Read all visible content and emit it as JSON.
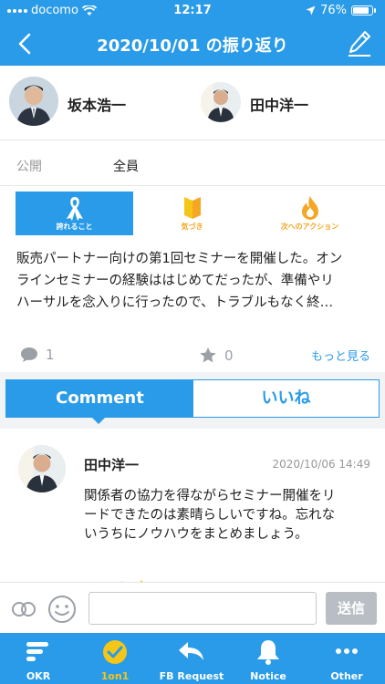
{
  "status_bar": {
    "carrier": "docomo",
    "time": "12:17",
    "battery": "76%"
  },
  "nav": {
    "title": "2020/10/01 の振り返り"
  },
  "people": {
    "left_name": "坂本浩一",
    "right_name": "田中洋一"
  },
  "visibility": {
    "label": "公開",
    "value": "全員"
  },
  "reflection_tabs": [
    {
      "label": "誇れること",
      "active": true,
      "icon": "ribbon-icon"
    },
    {
      "label": "気づき",
      "active": false,
      "icon": "beginner-mark-icon"
    },
    {
      "label": "次へのアクション",
      "active": false,
      "icon": "flame-icon"
    }
  ],
  "reflection": {
    "text_lines": [
      "販売パートナー向けの第1回セミナーを開催した。オン",
      "ラインセミナーの経験ははじめてだったが、準備やリ",
      "ハーサルを念入りに行ったので、トラブルもなく終…"
    ]
  },
  "stats": {
    "comments": "1",
    "likes": "0",
    "more": "もっと見る"
  },
  "segment": {
    "comment": "Comment",
    "like": "いいね"
  },
  "comment": {
    "author": "田中洋一",
    "date": "2020/10/06 14:49",
    "lines": [
      "関係者の協力を得ながらセミナー開催をリ",
      "ードできたのは素晴らしいですね。忘れな",
      "いうちにノウハウをまとめましょう。"
    ]
  },
  "input": {
    "placeholder": "",
    "send": "送信"
  },
  "tab_bar": [
    {
      "label": "OKR",
      "icon": "okr-icon",
      "active": false
    },
    {
      "label": "1on1",
      "icon": "check-circle-icon",
      "active": true
    },
    {
      "label": "FB Request",
      "icon": "reply-arrow-icon",
      "active": false
    },
    {
      "label": "Notice",
      "icon": "bell-icon",
      "active": false
    },
    {
      "label": "Other",
      "icon": "more-icon",
      "active": false
    }
  ],
  "colors": {
    "primary": "#2a9be8",
    "accent_orange": "#f5a623",
    "active_tab_yellow": "#f5c518",
    "send_disabled": "#b9bec4"
  }
}
